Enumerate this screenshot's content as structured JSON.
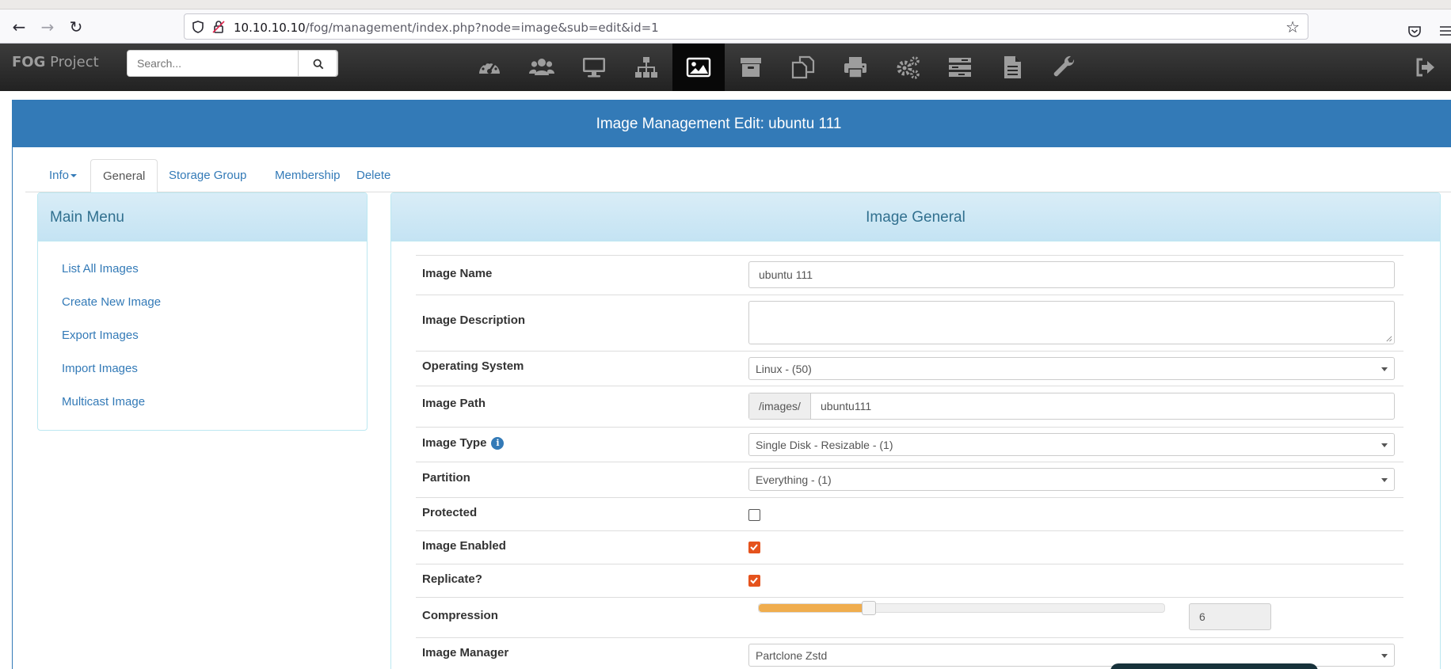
{
  "browser": {
    "url_host": "10.10.10.10",
    "url_path": "/fog/management/index.php?node=image&sub=edit&id=1",
    "icons": [
      "back-arrow-icon",
      "forward-arrow-icon",
      "reload-icon",
      "shield-icon",
      "insecure-lock-icon",
      "star-icon",
      "pocket-icon",
      "menu-icon"
    ]
  },
  "navbar": {
    "brand_bold": "FOG",
    "brand_rest": " Project",
    "search_placeholder": "Search...",
    "icons": [
      "dashboard-icon",
      "users-icon",
      "hosts-icon",
      "groups-icon",
      "images-icon",
      "storage-icon",
      "snapins-icon",
      "printers-icon",
      "service-icon",
      "tasks-icon",
      "reports-icon",
      "settings-icon",
      "logout-icon"
    ],
    "active_icon": "images-icon"
  },
  "page": {
    "title": "Image Management Edit: ubuntu 111",
    "tabs": [
      {
        "label": "Info"
      },
      {
        "label": "General"
      },
      {
        "label": "Storage Group"
      },
      {
        "label": "Membership"
      },
      {
        "label": "Delete"
      }
    ],
    "active_tab": "General"
  },
  "menu": {
    "heading": "Main Menu",
    "items": [
      "List All Images",
      "Create New Image",
      "Export Images",
      "Import Images",
      "Multicast Image"
    ]
  },
  "general": {
    "heading": "Image General",
    "image_name_label": "Image Name",
    "image_name_value": "ubuntu 111",
    "image_description_label": "Image Description",
    "image_description_value": "",
    "os_label": "Operating System",
    "os_value": "Linux - (50)",
    "path_label": "Image Path",
    "path_prefix": "/images/",
    "path_value": "ubuntu111",
    "type_label": "Image Type",
    "type_value": "Single Disk - Resizable - (1)",
    "partition_label": "Partition",
    "partition_value": "Everything - (1)",
    "protected_label": "Protected",
    "protected": false,
    "enabled_label": "Image Enabled",
    "enabled": true,
    "replicate_label": "Replicate?",
    "replicate": true,
    "compression_label": "Compression",
    "compression_value": "6",
    "compression_fraction": 0.27,
    "manager_label": "Image Manager",
    "manager_value": "Partclone Zstd"
  },
  "colors": {
    "primary": "#337ab7",
    "checkbox": "#e5531d",
    "slider": "#f0ad4e"
  }
}
